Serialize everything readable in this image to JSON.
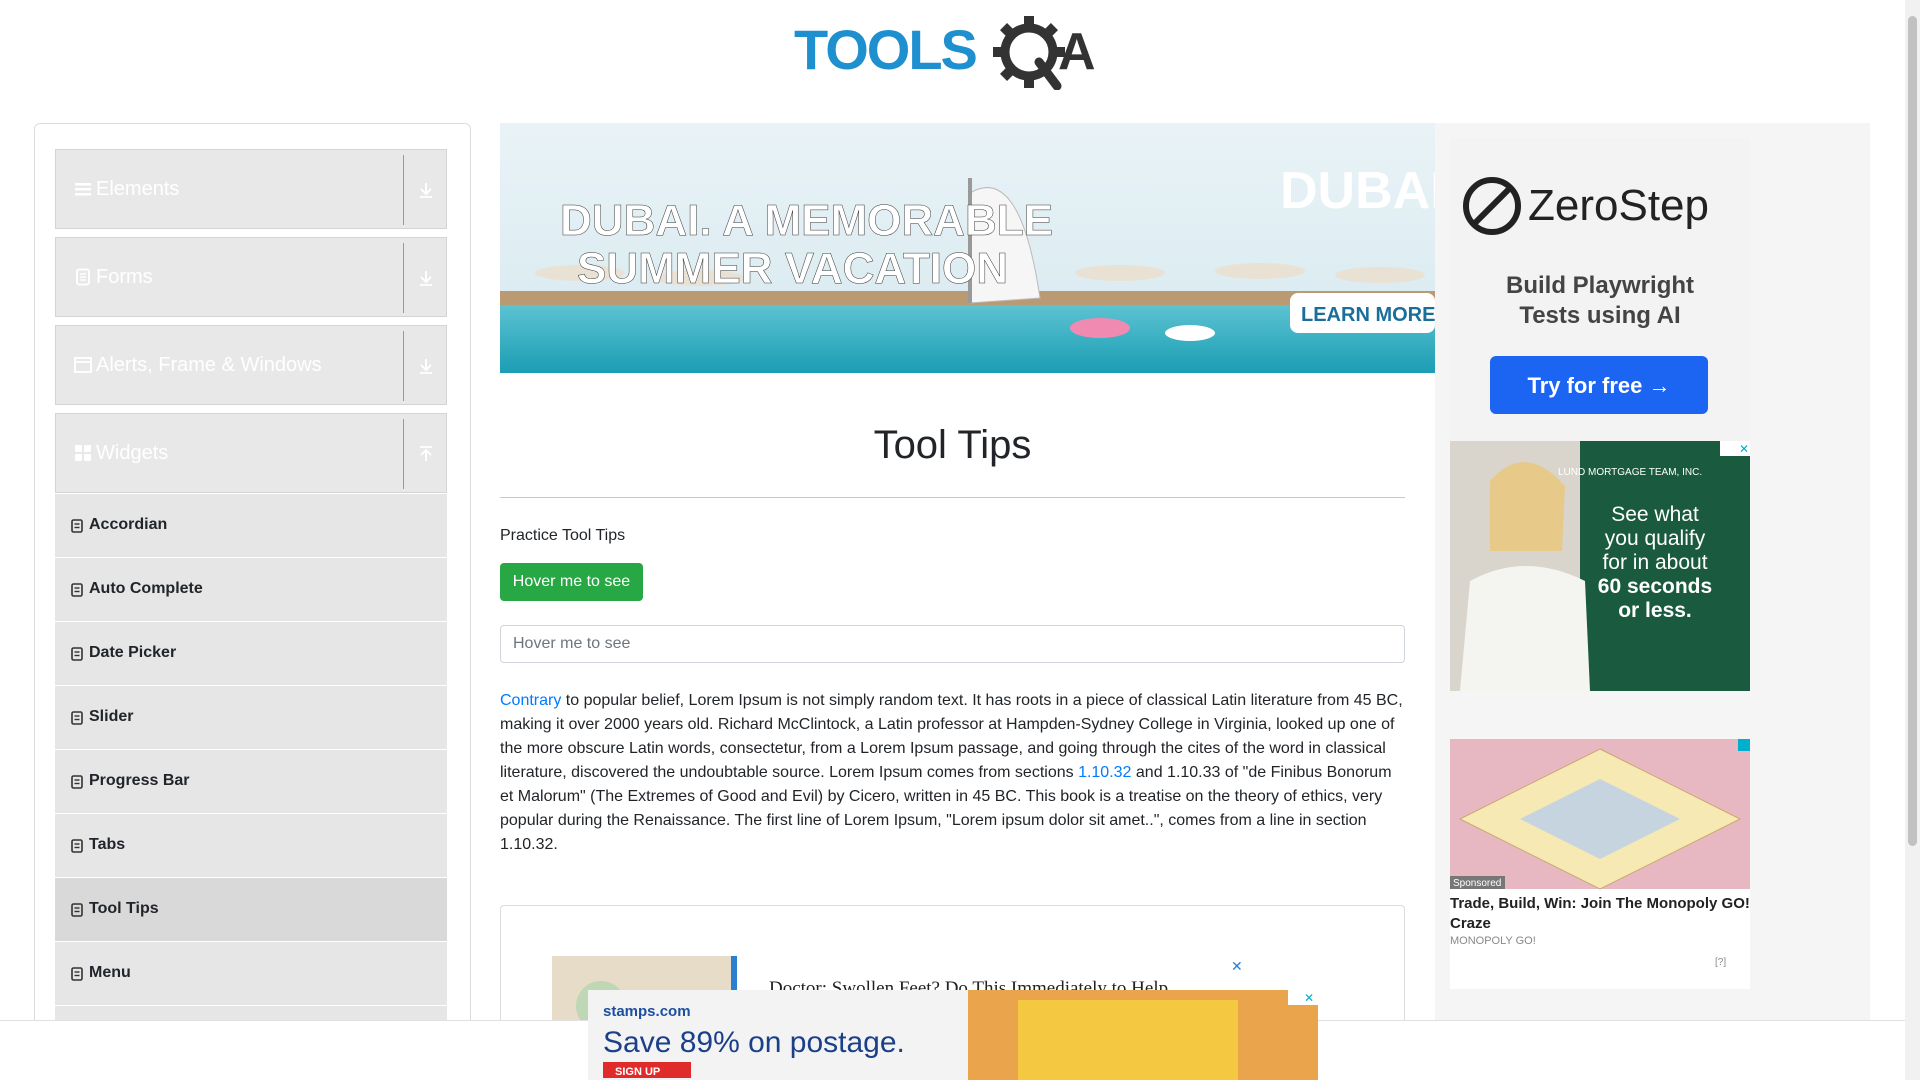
{
  "logo": {
    "text": "TOOLSQA"
  },
  "sidebar": {
    "groups": [
      {
        "label": "Elements",
        "icon": "hamburger-icon",
        "arrow": "download-icon"
      },
      {
        "label": "Forms",
        "icon": "document-icon",
        "arrow": "download-icon"
      },
      {
        "label": "Alerts, Frame & Windows",
        "icon": "window-icon",
        "arrow": "download-icon"
      },
      {
        "label": "Widgets",
        "icon": "grid-icon",
        "arrow": "upload-icon"
      }
    ],
    "items": [
      {
        "label": "Accordian",
        "active": false
      },
      {
        "label": "Auto Complete",
        "active": false
      },
      {
        "label": "Date Picker",
        "active": false
      },
      {
        "label": "Slider",
        "active": false
      },
      {
        "label": "Progress Bar",
        "active": false
      },
      {
        "label": "Tabs",
        "active": false
      },
      {
        "label": "Tool Tips",
        "active": true
      },
      {
        "label": "Menu",
        "active": false
      }
    ]
  },
  "main": {
    "title": "Tool Tips",
    "practice_label": "Practice Tool Tips",
    "button_label": "Hover me to see",
    "input_placeholder": "Hover me to see",
    "para": {
      "link1": "Contrary",
      "part1": " to popular belief, Lorem Ipsum is not simply random text. It has roots in a piece of classical Latin literature from 45 BC, making it over 2000 years old. Richard McClintock, a Latin professor at Hampden-Sydney College in Virginia, looked up one of the more obscure Latin words, consectetur, from a Lorem Ipsum passage, and going through the cites of the word in classical literature, discovered the undoubtable source. Lorem Ipsum comes from sections ",
      "link2": "1.10.32",
      "part2": " and 1.10.33 of \"de Finibus Bonorum et Malorum\" (The Extremes of Good and Evil) by Cicero, written in 45 BC. This book is a treatise on the theory of ethics, very popular during the Renaissance. The first line of Lorem Ipsum, \"Lorem ipsum dolor sit amet..\", comes from a line in section 1.10.32."
    }
  },
  "ads": {
    "dubai": {
      "line1": "DUBAI. A MEMORABLE",
      "line2": "SUMMER VACATION",
      "brand": "DUBAI",
      "cta": "LEARN MORE"
    },
    "zerostep": {
      "brand": "ZeroStep",
      "line1": "Build Playwright",
      "line2": "Tests using AI",
      "cta": "Try for free →"
    },
    "lund": {
      "brand": "LUND MORTGAGE TEAM, INC.",
      "line1": "See what",
      "line2": "you qualify",
      "line3": "for in about",
      "line4": "60 seconds",
      "line5": "or less."
    },
    "monopoly": {
      "sponsored": "Sponsored",
      "title": "Trade, Build, Win: Join The Monopoly GO! Craze",
      "source": "MONOPOLY GO!",
      "help": "[?]"
    },
    "doctor": {
      "title": "Doctor: Swollen Feet? Do This Immediately to Help"
    },
    "stamps": {
      "brand": "stamps.com",
      "headline": "Save 89% on postage.",
      "cta": "SIGN UP"
    }
  },
  "colors": {
    "brand_blue": "#1e8fcf",
    "success": "#28a745",
    "link": "#007bff"
  }
}
